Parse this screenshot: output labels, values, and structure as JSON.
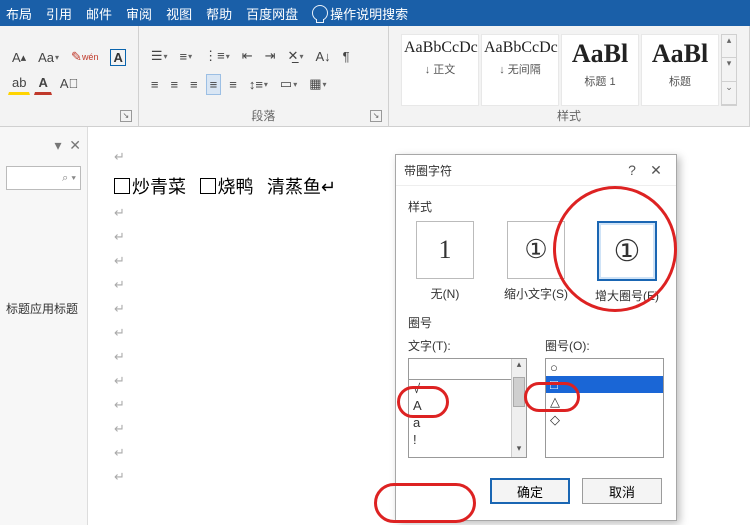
{
  "menu": [
    "布局",
    "引用",
    "邮件",
    "审阅",
    "视图",
    "帮助",
    "百度网盘"
  ],
  "tell_me": "操作说明搜索",
  "ribbon": {
    "paragraph_label": "段落",
    "styles_label": "样式",
    "styles": [
      {
        "sample": "AaBbCcDc",
        "name": "↓ 正文"
      },
      {
        "sample": "AaBbCcDc",
        "name": "↓ 无间隔"
      },
      {
        "sample": "AaBl",
        "name": "标题 1"
      },
      {
        "sample": "AaBl",
        "name": "标题"
      }
    ]
  },
  "nav": {
    "search_icon": "⌕ ▾",
    "heading": "标题应用标题"
  },
  "doc": {
    "item1": "炒青菜",
    "item2": "烧鸭",
    "item3": "清蒸鱼"
  },
  "dialog": {
    "title": "带圈字符",
    "section_style": "样式",
    "opts": [
      {
        "glyph": "1",
        "label": "无(N)"
      },
      {
        "glyph": "①",
        "label": "缩小文字(S)"
      },
      {
        "glyph": "①",
        "label": "增大圈号(E)"
      }
    ],
    "section_ring": "圈号",
    "text_label": "文字(T):",
    "ring_label": "圈号(O):",
    "text_items": [
      "√",
      "A",
      "a",
      "!"
    ],
    "ring_items": [
      "○",
      "□",
      "△",
      "◇"
    ],
    "ok": "确定",
    "cancel": "取消"
  }
}
